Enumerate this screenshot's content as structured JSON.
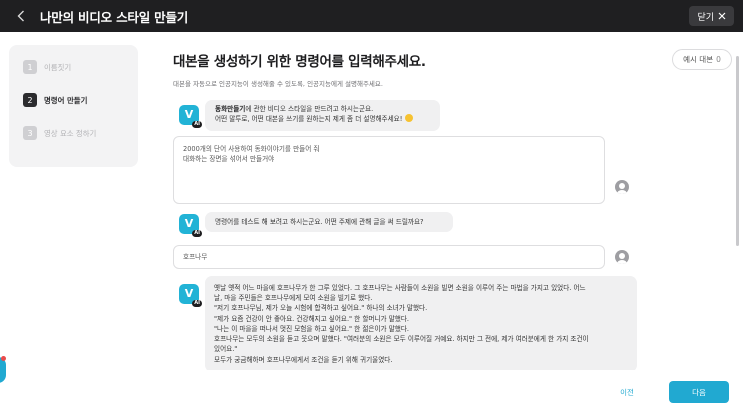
{
  "header": {
    "back_icon": "chevron-left-icon",
    "title": "나만의 비디오 스타일 만들기",
    "close_label": "닫기",
    "close_icon": "close-icon"
  },
  "steps": [
    {
      "num": "1",
      "label": "이름짓기",
      "active": false
    },
    {
      "num": "2",
      "label": "명령어 만들기",
      "active": true
    },
    {
      "num": "3",
      "label": "영상 요소 정하기",
      "active": false
    }
  ],
  "main": {
    "title": "대본을 생성하기 위한 명령어를 입력해주세요.",
    "subtitle": "대본을 자동으로 인공지능이 생성해줄 수 있도록, 인공지능에게 설명해주세요.",
    "example_label": "예시 대본",
    "example_count": "0"
  },
  "avatar": {
    "letter": "V",
    "badge": "AI"
  },
  "messages": {
    "ai1": {
      "bold": "동화만들기",
      "text1": "에 관한 비디오 스타일을 만드려고 하시는군요.",
      "text2": "어떤 말투로, 어떤 대본을 쓰기를 원하는지 제게 좀 더 설명해주세요! "
    },
    "user1_lines": [
      "2000개의 단어 사용하여 동화이야기를 만들어 줘",
      "대화하는 장면을 섞어서 만들거야"
    ],
    "ai2": "명령어를 테스트 해 보려고 하시는군요. 어떤 주제에 관해 글을 써 드릴까요?",
    "user2": "호프나무",
    "ai3_lines": [
      "옛날 옛적 어느 마을에 호프나무가 한 그루 있었다. 그 호프나무는 사람들이 소원을 빌면 소원을 이루어 주는 마법을 가지고 있었다. 어느",
      "날, 마을 주민들은 호프나무에게 모여 소원을 빌기로 했다.",
      "\"저기 호프나무님, 제가 오늘 시험에 합격하고 싶어요.\" 하나의 소녀가 말했다.",
      "\"제가 요즘 건강이 안 좋아요. 건강해지고 싶어요.\" 한 할머니가 말했다.",
      "\"나는 이 마을을 떠나서 멋진 모험을 하고 싶어요.\" 한 젊은이가 말했다.",
      "호프나무는 모두의 소원을 듣고 웃으며 말했다. \"여러분의 소원은 모두 이루어질 거예요. 하지만 그 전에, 제가 여러분에게 한 가지 조건이",
      "있어요.\"",
      "모두가 궁금해하며 호프나무에게서 조건을 듣기 위해 귀기울였다."
    ]
  },
  "footer": {
    "prev_label": "이전",
    "next_label": "다음"
  },
  "colors": {
    "accent": "#21a9d1",
    "topbar": "#1f1f21"
  }
}
